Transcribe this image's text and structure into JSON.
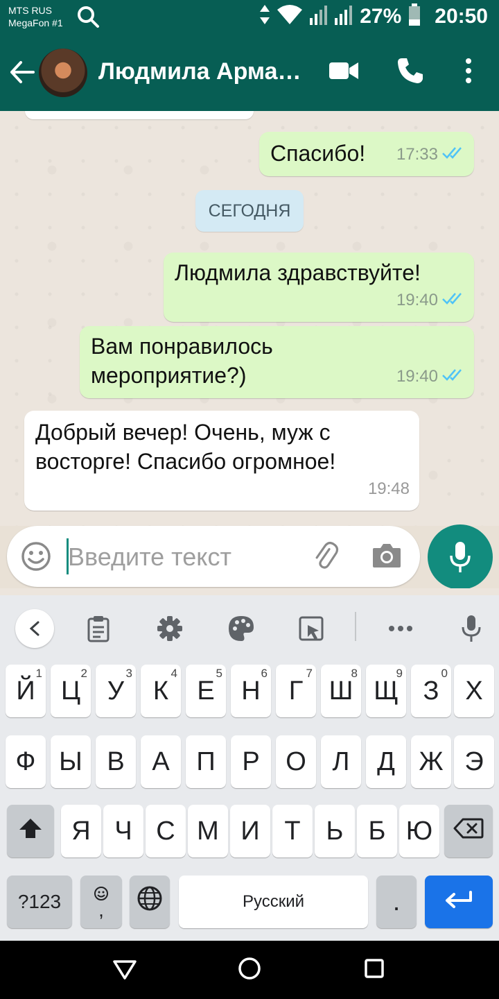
{
  "status_bar": {
    "carrier_line1": "MTS RUS",
    "carrier_line2": "MegaFon #1",
    "battery": "27%",
    "time": "20:50"
  },
  "app_bar": {
    "contact_name": "Людмила Армашева"
  },
  "messages": [
    {
      "direction": "out",
      "text": "Спасибо!",
      "time": "17:33",
      "read": true
    },
    {
      "direction": "out",
      "text": "Людмила здравствуйте!",
      "time": "19:40",
      "read": true
    },
    {
      "direction": "out",
      "text_lines": [
        "Вам понравилось",
        "мероприятие?)"
      ],
      "time": "19:40",
      "read": true
    },
    {
      "direction": "in",
      "text_lines": [
        "Добрый вечер! Очень, муж с",
        "восторге! Спасибо огромное!"
      ],
      "time": "19:48"
    }
  ],
  "date_divider": "СЕГОДНЯ",
  "composer": {
    "placeholder": "Введите текст"
  },
  "keyboard": {
    "row1": [
      {
        "label": "Й",
        "hint": "1"
      },
      {
        "label": "Ц",
        "hint": "2"
      },
      {
        "label": "У",
        "hint": "3"
      },
      {
        "label": "К",
        "hint": "4"
      },
      {
        "label": "Е",
        "hint": "5"
      },
      {
        "label": "Н",
        "hint": "6"
      },
      {
        "label": "Г",
        "hint": "7"
      },
      {
        "label": "Ш",
        "hint": "8"
      },
      {
        "label": "Щ",
        "hint": "9"
      },
      {
        "label": "З",
        "hint": "0"
      },
      {
        "label": "Х",
        "hint": ""
      }
    ],
    "row2": [
      "Ф",
      "Ы",
      "В",
      "А",
      "П",
      "Р",
      "О",
      "Л",
      "Д",
      "Ж",
      "Э"
    ],
    "row3": [
      "Я",
      "Ч",
      "С",
      "М",
      "И",
      "Т",
      "Ь",
      "Б",
      "Ю"
    ],
    "symbols_key": "?123",
    "comma_key": ",",
    "space_label": "Русский",
    "period_key": "."
  },
  "colors": {
    "header": "#075e54",
    "accent": "#128c7e",
    "outgoing_bubble": "#dcf8c6",
    "read_ticks": "#4fc3f7",
    "enter_key": "#1a73e8"
  }
}
